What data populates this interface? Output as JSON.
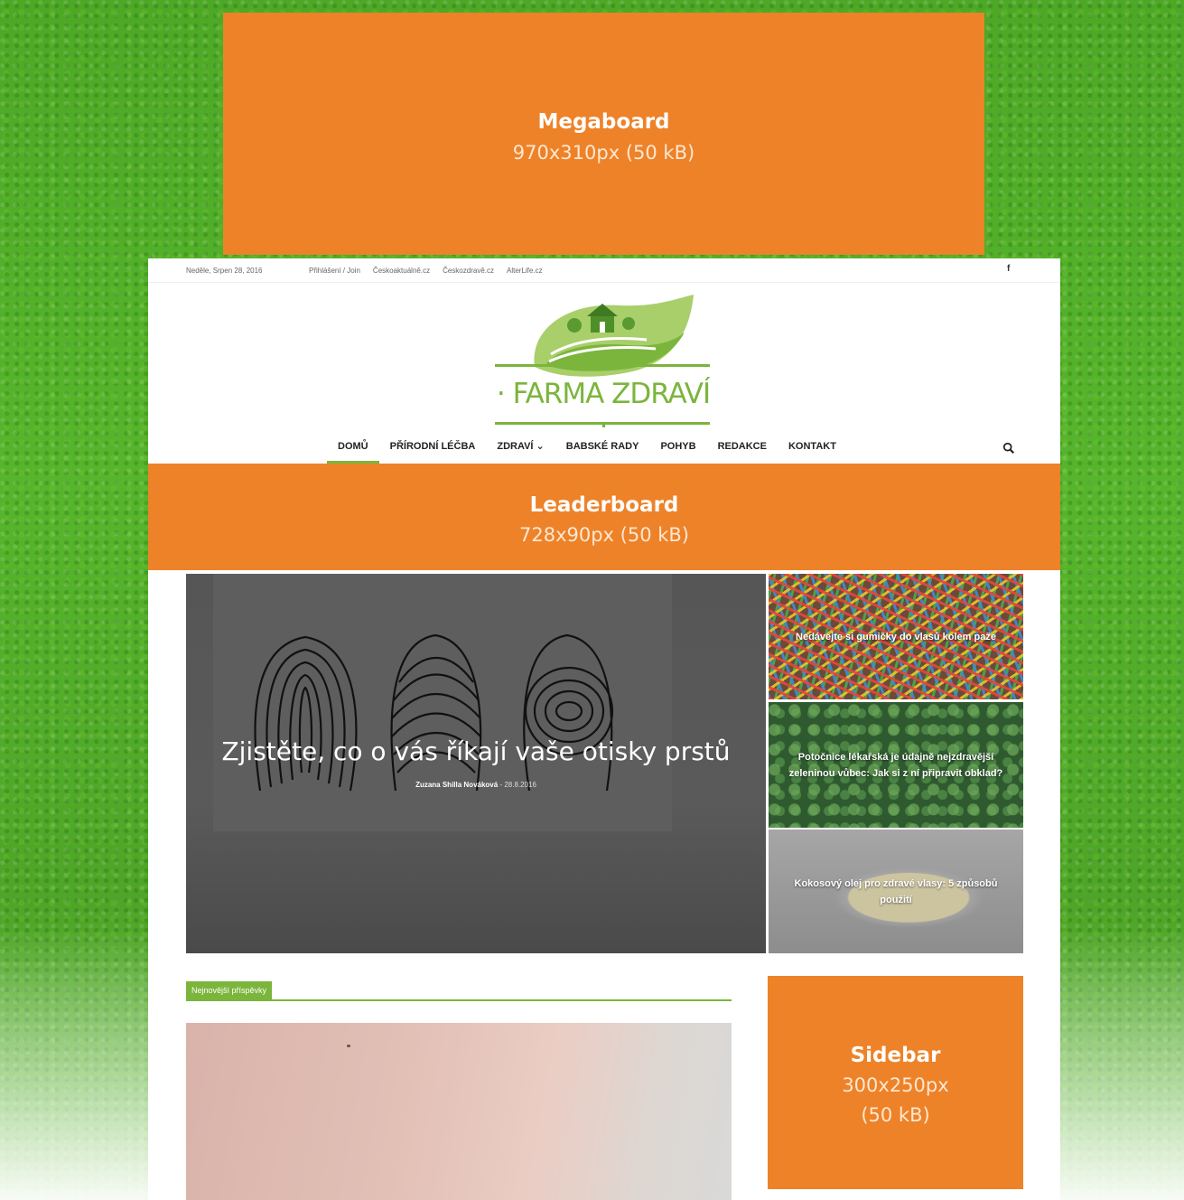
{
  "megaboard": {
    "title": "Megaboard",
    "size": "970x310px (50 kB)"
  },
  "topbar": {
    "date": "Neděle, Srpen 28, 2016",
    "links": [
      "Přihlášení / Join",
      "Českoaktuálně.cz",
      "Českozdravě.cz",
      "AlterLife.cz"
    ],
    "social_icon": "f"
  },
  "logo": {
    "text": "· FARMA ZDRAVÍ ·",
    "icon": "farm-leaf-logo-icon"
  },
  "nav": {
    "items": [
      {
        "label": "DOMŮ",
        "active": true
      },
      {
        "label": "PŘÍRODNÍ LÉČBA"
      },
      {
        "label": "ZDRAVÍ ⌄"
      },
      {
        "label": "BABSKÉ RADY"
      },
      {
        "label": "POHYB"
      },
      {
        "label": "REDAKCE"
      },
      {
        "label": "KONTAKT"
      }
    ],
    "search_icon": "search-icon"
  },
  "leaderboard": {
    "title": "Leaderboard",
    "size": "728x90px (50 kB)"
  },
  "featured": {
    "title": "Zjistěte, co o vás říkají vaše otisky prstů",
    "author": "Zuzana Shilla Nováková",
    "date": "28.8.2016"
  },
  "side_cards": [
    {
      "title": "Nedávejte si gumičky do vlasů kolem paže"
    },
    {
      "title": "Potočnice lékařská je údajně nejzdravější zeleninou vůbec: Jak si z ní připravit obklad?"
    },
    {
      "title": "Kokosový olej pro zdravé vlasy: 5 způsobů použití"
    }
  ],
  "section": {
    "tab_label": "Nejnovější příspěvky"
  },
  "sidebar_ad": {
    "title": "Sidebar",
    "size_line1": "300x250px",
    "size_line2": "(50 kB)"
  },
  "colors": {
    "accent_orange": "#ee8228",
    "brand_green": "#7bb53c"
  }
}
